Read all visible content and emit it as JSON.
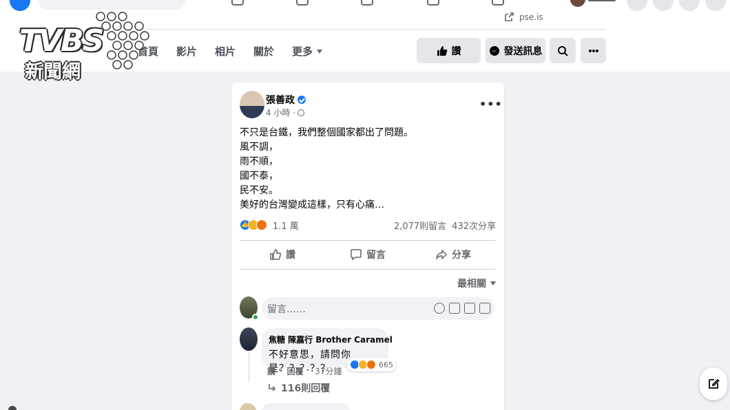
{
  "watermark": {
    "brand": "TVBS",
    "subtitle": "新聞網"
  },
  "header": {
    "link_text": "pse.is",
    "tabs": [
      "首頁",
      "影片",
      "相片",
      "關於",
      "更多"
    ],
    "like_button": "讚",
    "message_button": "發送訊息"
  },
  "post": {
    "author": "張善政",
    "time": "4 小時 ·",
    "lines": [
      "不只是台鐵，我們整個國家都出了問題。",
      "風不調，",
      "雨不順，",
      "國不泰，",
      "民不安。",
      "美好的台灣變成這樣，只有心痛…"
    ],
    "reaction_count": "1.1 萬",
    "comment_count": "2,077則留言",
    "share_count": "432次分享",
    "actions": {
      "like": "讚",
      "comment": "留言",
      "share": "分享"
    },
    "sort_label": "最相關",
    "comment_placeholder": "留言……",
    "top_comment": {
      "author": "焦糖 陳嘉行 Brother Caramel",
      "text": "不好意思，請問你是？？？？？",
      "reactions": "665",
      "like": "讚",
      "reply": "回覆",
      "time": "37分鐘",
      "replies": "116則回覆"
    }
  },
  "colors": {
    "accent": "#1877f2",
    "background": "#eff1f5",
    "secondary_text": "#65676b"
  }
}
